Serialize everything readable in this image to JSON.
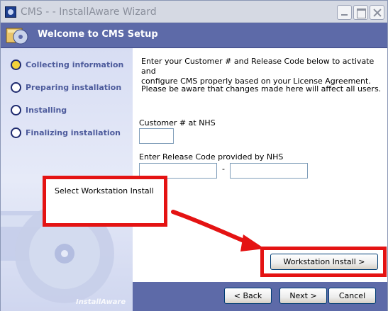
{
  "window": {
    "title": "CMS -  - InstallAware Wizard",
    "icon": "installer-icon",
    "controls": [
      "minimize-icon",
      "maximize-icon",
      "close-icon"
    ]
  },
  "banner": {
    "title": "Welcome to CMS Setup",
    "icon": "setup-disc-icon"
  },
  "steps": [
    {
      "label": "Collecting information",
      "active": true
    },
    {
      "label": "Preparing installation",
      "active": false
    },
    {
      "label": "Installing",
      "active": false
    },
    {
      "label": "Finalizing installation",
      "active": false
    }
  ],
  "brand": "InstallAware",
  "content": {
    "intro_line1": "Enter your Customer # and Release Code below to activate and",
    "intro_line2": "configure CMS properly based on your License Agreement.",
    "warning": "Please be aware that changes made here will affect all users.",
    "customer_label": "Customer # at NHS",
    "customer_value": "",
    "release_label": "Enter Release Code provided by NHS",
    "release_value_1": "",
    "release_separator": "-",
    "release_value_2": ""
  },
  "annotation": {
    "callout_text": "Select Workstation Install",
    "highlight_color": "#e41313"
  },
  "buttons": {
    "workstation": "Workstation Install >",
    "back": "< Back",
    "next": "Next >",
    "cancel": "Cancel"
  },
  "colors": {
    "banner": "#5d6aa8",
    "step_text": "#4d5b9c",
    "active_step": "#f3d23a"
  }
}
